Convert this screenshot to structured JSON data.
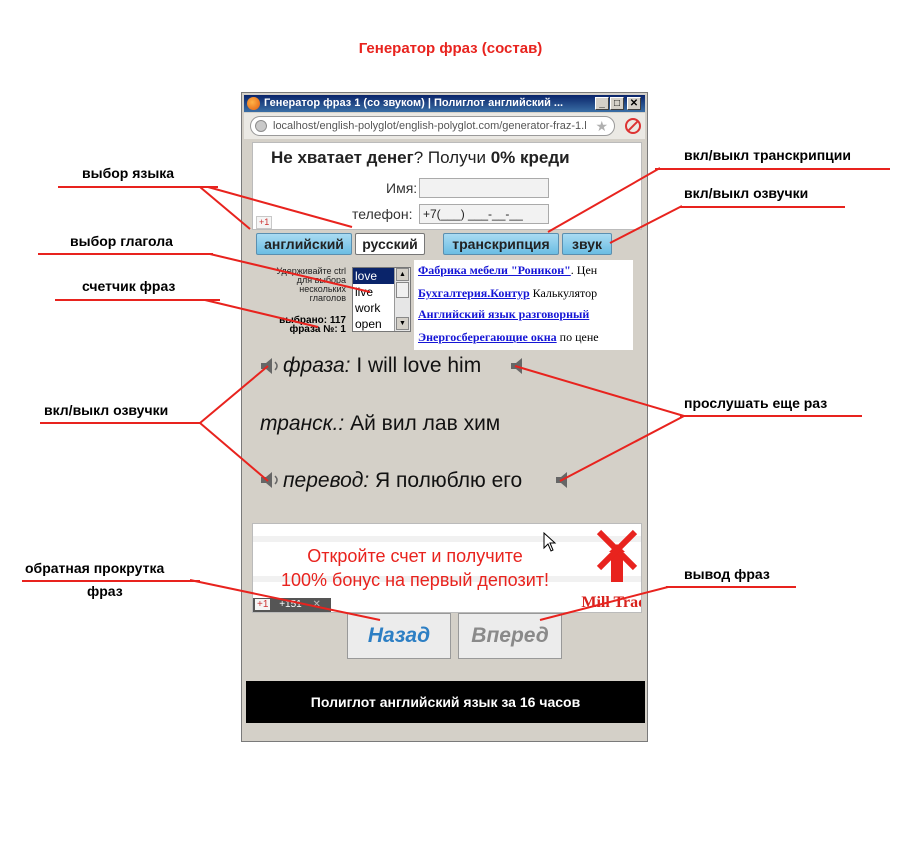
{
  "doc_title": "Генератор фраз (состав)",
  "annotations": {
    "lang_select": "выбор языка",
    "verb_select": "выбор глагола",
    "phrase_counter": "счетчик фраз",
    "sound_toggle_left": "вкл/выкл озвучки",
    "back_scroll_line1": "обратная прокрутка",
    "back_scroll_line2": "фраз",
    "transcription_toggle": "вкл/выкл транскрипции",
    "sound_toggle_right": "вкл/выкл озвучки",
    "replay": "прослушать еще раз",
    "output": "вывод фраз"
  },
  "window": {
    "title": "Генератор фраз 1 (со звуком) | Полиглот английский ...",
    "url": "localhost/english-polyglot/english-polyglot.com/generator-fraz-1.l",
    "minimize": "_",
    "maximize": "□",
    "close": "✕"
  },
  "ad_top": {
    "headline_bold1": "Не хватает денег",
    "headline_mid": "? Получи ",
    "headline_bold2": "0% креди",
    "name_label": "Имя:",
    "phone_label": "телефон:",
    "phone_value": "+7(___) ___-__-__",
    "gplus": "+1"
  },
  "tabs": {
    "english": "английский",
    "russian": "русский",
    "transcription": "транскрипция",
    "sound": "звук"
  },
  "verbs": {
    "hint_lines": [
      "Удерживайте ctrl",
      "для выбора",
      "нескольких",
      "глаголов"
    ],
    "selected_count": "выбрано: 117",
    "phrase_number": "фраза №: 1",
    "items": [
      "love",
      "live",
      "work",
      "open"
    ]
  },
  "links": [
    {
      "title": "Фабрика мебели \"Роникон\"",
      "tail": ". Цен"
    },
    {
      "title": "Бухгалтерия.Контур",
      "tail": " Калькулятор"
    },
    {
      "title": "Английский язык разговорный",
      "tail": ""
    },
    {
      "title": "Энергосберегающие окна",
      "tail": " по цене"
    }
  ],
  "phrase": {
    "label": "фраза:",
    "text": " I will love him"
  },
  "transcription": {
    "label": "транск.:",
    "text": " Ай вил лав хим"
  },
  "translation": {
    "label": "перевод:",
    "text": " Я полюблю его"
  },
  "ad_bottom": {
    "line1": "Откройте счет и получите",
    "line2": "100% бонус на первый депозит!",
    "brand": "Mill Trad",
    "gplus": "+1",
    "count": "+151",
    "close": "✕"
  },
  "buttons": {
    "back": "Назад",
    "forward": "Вперед"
  },
  "footer": "Полиглот английский язык за 16 часов",
  "colors": {
    "annotation": "#e8231e",
    "tab_blue": "#6bbde3",
    "back_text": "#2d7fc4",
    "forward_text": "#8a8a8a"
  }
}
